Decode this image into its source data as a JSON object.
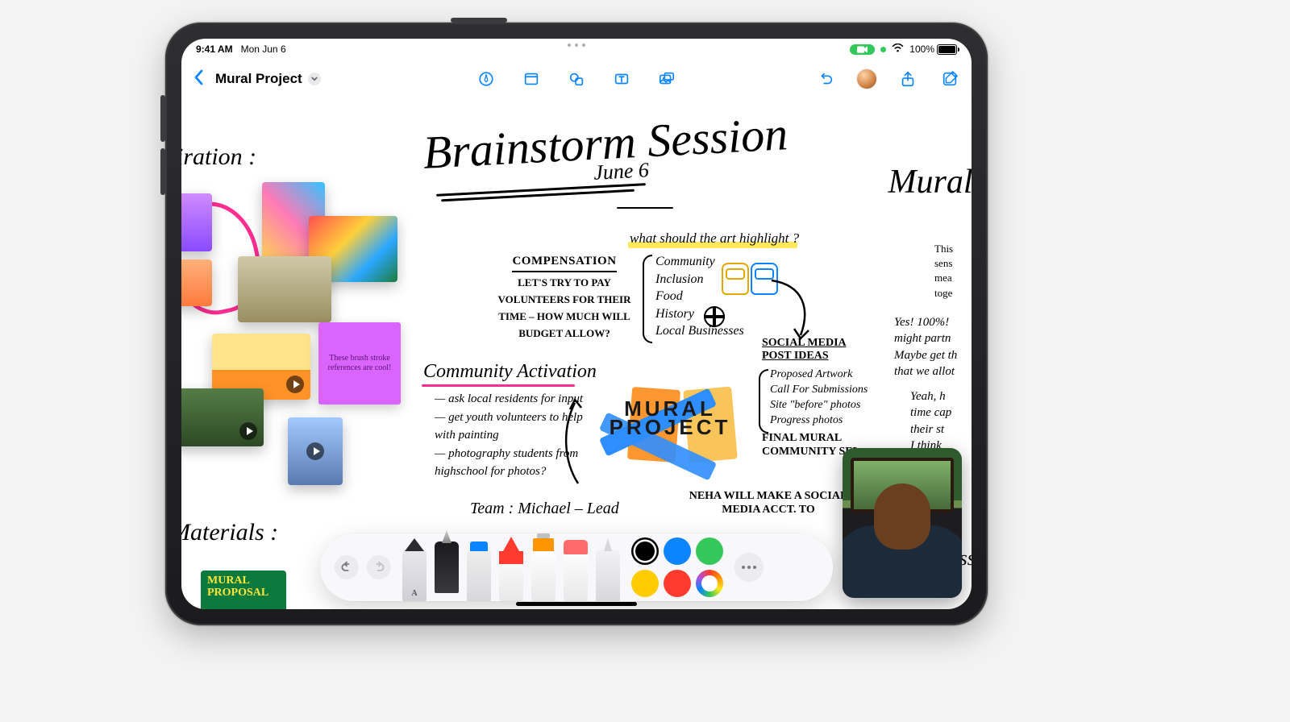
{
  "status": {
    "time": "9:41 AM",
    "date": "Mon Jun 6",
    "facetime_active": true,
    "battery_pct": "100%"
  },
  "toolbar": {
    "doc_title": "Mural Project"
  },
  "canvas": {
    "heading_inspiration": "iration :",
    "heading_materials": "Materials :",
    "big_title_a": "Brainstorm Session",
    "big_title_date": "June 6",
    "sticky_note": "These brush stroke references are cool!",
    "compensation": {
      "head": "COMPENSATION",
      "body": "LET'S TRY TO PAY VOLUNTEERS FOR THEIR TIME – HOW MUCH WILL BUDGET ALLOW?"
    },
    "activation": {
      "head": "Community Activation",
      "l1": "— ask local residents for input",
      "l2": "— get youth volunteers to help with painting",
      "l3": "— photography students from highschool for photos?",
      "team": "Team : Michael – Lead"
    },
    "mural_label_a": "MURAL",
    "mural_label_b": "PROJECT",
    "highlight_q": "what should the art highlight ?",
    "highlight_items": [
      "Community",
      "Inclusion",
      "Food",
      "History",
      "Local Businesses"
    ],
    "social": {
      "head_a": "SOCIAL MEDIA",
      "head_b": "POST IDEAS",
      "l1": "Proposed Artwork",
      "l2": "Call For Submissions",
      "l3": "Site \"before\" photos",
      "l4": "Progress photos",
      "l5": "FINAL MURAL",
      "l6": "COMMUNITY SEL"
    },
    "neha": "NEHA WILL MAKE A SOCIAL MEDIA ACCT. TO",
    "right_title": "Mural C",
    "right_p1": "This\nsens\nmea\ntoge",
    "right_p2": "Yes! 100%!\nmight partn\nMaybe get th\nthat we allot",
    "right_p3": "Yeah, h\ntime cap\ntheir st\nI think",
    "right_process": "Process :",
    "proposal_a": "MURAL",
    "proposal_b": "PROPOSAL"
  },
  "dock": {
    "colors": {
      "black": "#000000",
      "blue": "#0a84ff",
      "green": "#34c759",
      "yellow": "#ffcc00",
      "red": "#ff3b30"
    }
  }
}
